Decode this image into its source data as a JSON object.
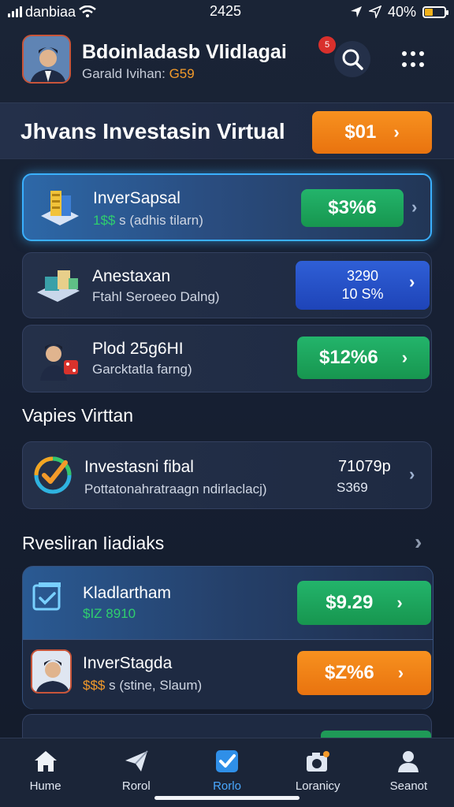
{
  "status_bar": {
    "carrier": "danbiaa",
    "time": "2425",
    "battery": "40%",
    "battery_level": 0.4
  },
  "header": {
    "user_name": "Bdoinladasb Vlidlagai",
    "user_sub_label": "Garald Ivihan:",
    "user_sub_value": "G59",
    "notification_badge": "5"
  },
  "banner": {
    "title": "Jhvans Investasin Virtual",
    "button_label": "$01"
  },
  "cards_top": [
    {
      "title": "InverSapsal",
      "sub_highlight": "1$$",
      "sub_text": "s (adhis tilarn)",
      "value": "$3%6",
      "value_color": "green",
      "icon": "server-stack-icon"
    },
    {
      "title": "Anestaxan",
      "sub_text": "Ftahl Seroeeo Dalng)",
      "value_line1": "3290",
      "value_line2": "10 S%",
      "value_color": "blue",
      "icon": "boxes-icon"
    },
    {
      "title": "Plod 25g6HI",
      "sub_text": "Garcktatla farng)",
      "value": "$12%6",
      "value_color": "green",
      "icon": "person-dice-icon"
    }
  ],
  "section_virtual": {
    "title": "Vapies Virttan"
  },
  "card_virtual": {
    "title": "Investasni fibal",
    "sub_text": "Pottatonahratraagn ndirlaclacj)",
    "value_line1": "71079p",
    "value_line2": "S369",
    "icon": "check-circle-icon"
  },
  "section_reports": {
    "title": "Rvesliran Iiadiaks"
  },
  "cards_bottom": [
    {
      "title": "Kladlartham",
      "sub_text": "$IZ 8910",
      "value": "$9.29",
      "value_color": "green",
      "icon": "document-check-icon"
    },
    {
      "title": "InverStagda",
      "sub_highlight": "$$$",
      "sub_text": "s (stine, Slaum)",
      "value": "$Z%6",
      "value_color": "orange",
      "icon": "person-avatar-icon"
    }
  ],
  "bottom_nav": [
    {
      "label": "Hume",
      "icon": "home-icon",
      "active": false
    },
    {
      "label": "Rorol",
      "icon": "paper-plane-icon",
      "active": false
    },
    {
      "label": "Rorlo",
      "icon": "check-square-icon",
      "active": true
    },
    {
      "label": "Loranicy",
      "icon": "camera-icon",
      "active": false
    },
    {
      "label": "Seanot",
      "icon": "user-icon",
      "active": false
    }
  ]
}
